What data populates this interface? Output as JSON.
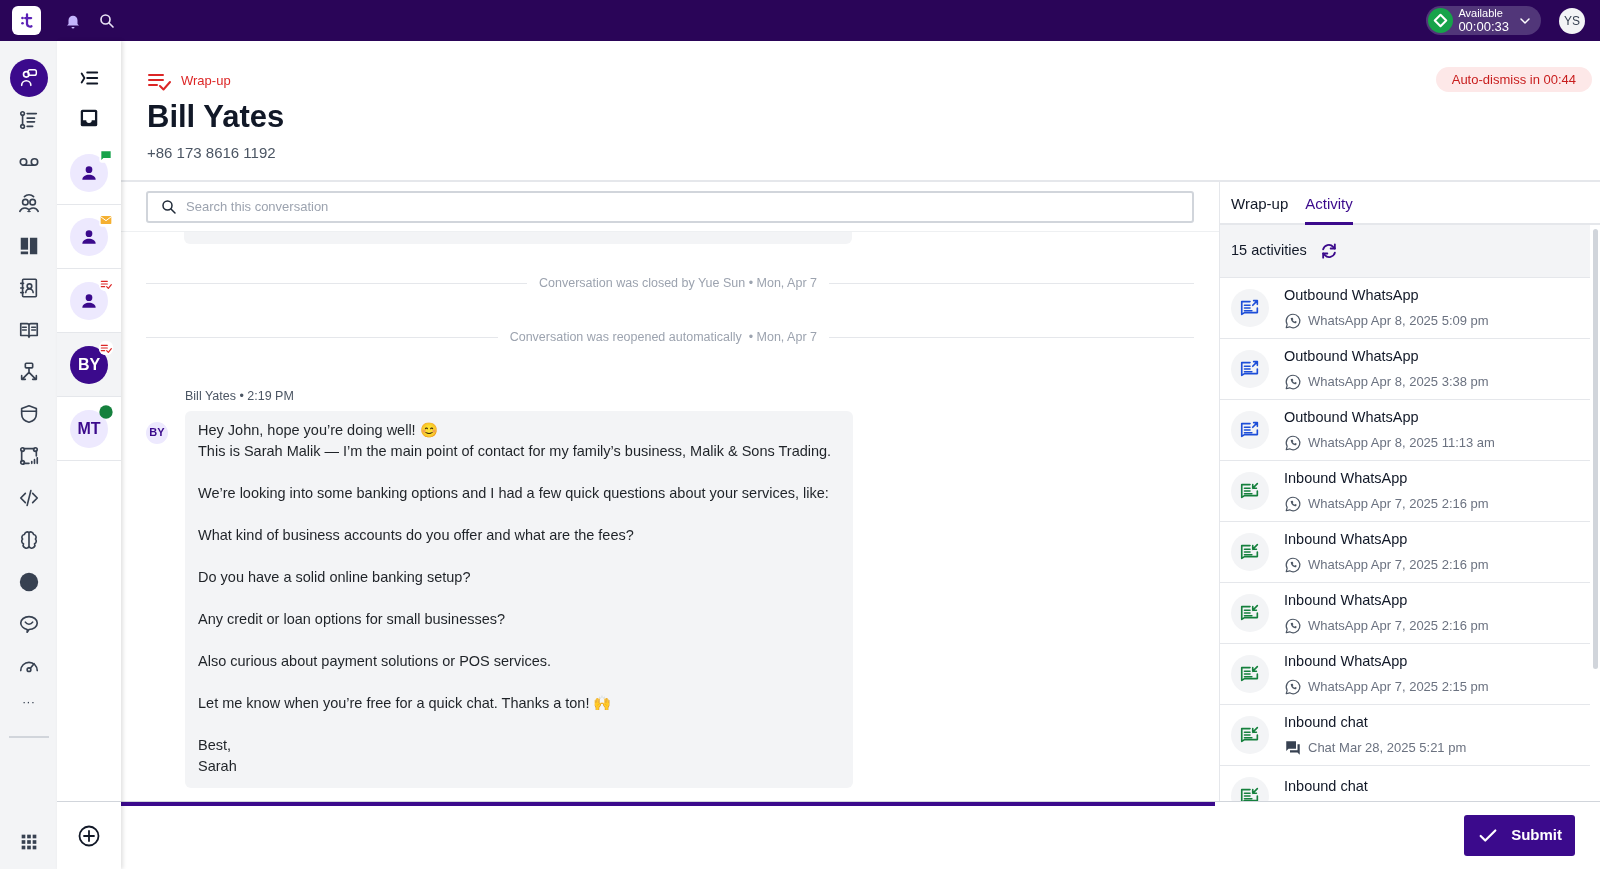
{
  "topbar": {
    "status": {
      "label": "Available",
      "timer": "00:00:33"
    },
    "avatar": "YS"
  },
  "rail": {
    "items": [
      {
        "selected": true
      },
      {
        "selected": false
      },
      {
        "selected": false
      },
      {
        "selected": false
      },
      {
        "selected": false
      },
      {
        "selected": false
      },
      {
        "selected": false
      },
      {
        "selected": false
      },
      {
        "selected": false
      },
      {
        "selected": false
      },
      {
        "selected": false
      },
      {
        "selected": false
      },
      {
        "selected": false
      },
      {
        "selected": false
      },
      {
        "selected": false
      }
    ],
    "more": "···"
  },
  "conversations": [
    {
      "kind": "person",
      "badge": {
        "kind": "chat"
      },
      "selected": false
    },
    {
      "kind": "person",
      "badge": {
        "kind": "mail"
      },
      "selected": false
    },
    {
      "kind": "person",
      "badge": {
        "kind": "wrapup"
      },
      "selected": false
    },
    {
      "kind": "initials",
      "initials": "BY",
      "badge": {
        "kind": "wrapup"
      },
      "selected": true
    },
    {
      "kind": "initials",
      "initials": "MT",
      "badge": {
        "kind": "online"
      },
      "selected": false
    }
  ],
  "header": {
    "state": "Wrap-up",
    "name": "Bill Yates",
    "phone": "+86 173 8616 1192",
    "auto_dismiss": "Auto-dismiss in 00:44"
  },
  "search": {
    "placeholder": "Search this conversation"
  },
  "events": [
    "Conversation was closed by Yue Sun • Mon, Apr 7",
    "Conversation was reopened automatically  • Mon, Apr 7"
  ],
  "message": {
    "avatar": "BY",
    "meta": "Bill Yates • 2:19 PM",
    "paragraphs": [
      [
        "Hey John, hope you’re doing well! 😊",
        "This is Sarah Malik — I’m the main point of contact for my family’s business, Malik & Sons Trading."
      ],
      [
        "We’re looking into some banking options and I had a few quick questions about your services, like:"
      ],
      [
        "What kind of business accounts do you offer and what are the fees?"
      ],
      [
        "Do you have a solid online banking setup?"
      ],
      [
        "Any credit or loan options for small businesses?"
      ],
      [
        "Also curious about payment solutions or POS services."
      ],
      [
        "Let me know when you’re free for a quick chat. Thanks a ton! 🙌"
      ],
      [
        "Best,",
        "Sarah"
      ]
    ]
  },
  "panel": {
    "tabs": [
      {
        "label": "Wrap-up",
        "selected": false
      },
      {
        "label": "Activity",
        "selected": true
      }
    ],
    "count": "15 activities",
    "activities": [
      {
        "kind": "outbound",
        "title": "Outbound WhatsApp",
        "channel": {
          "kind": "whatsapp"
        },
        "meta": "WhatsApp Apr 8, 2025 5:09 pm"
      },
      {
        "kind": "outbound",
        "title": "Outbound WhatsApp",
        "channel": {
          "kind": "whatsapp"
        },
        "meta": "WhatsApp Apr 8, 2025 3:38 pm"
      },
      {
        "kind": "outbound",
        "title": "Outbound WhatsApp",
        "channel": {
          "kind": "whatsapp"
        },
        "meta": "WhatsApp Apr 8, 2025 11:13 am"
      },
      {
        "kind": "inbound",
        "title": "Inbound WhatsApp",
        "channel": {
          "kind": "whatsapp"
        },
        "meta": "WhatsApp Apr 7, 2025 2:16 pm"
      },
      {
        "kind": "inbound",
        "title": "Inbound WhatsApp",
        "channel": {
          "kind": "whatsapp"
        },
        "meta": "WhatsApp Apr 7, 2025 2:16 pm"
      },
      {
        "kind": "inbound",
        "title": "Inbound WhatsApp",
        "channel": {
          "kind": "whatsapp"
        },
        "meta": "WhatsApp Apr 7, 2025 2:16 pm"
      },
      {
        "kind": "inbound",
        "title": "Inbound WhatsApp",
        "channel": {
          "kind": "whatsapp"
        },
        "meta": "WhatsApp Apr 7, 2025 2:15 pm"
      },
      {
        "kind": "inbound",
        "title": "Inbound chat",
        "channel": {
          "kind": "chat"
        },
        "meta": "Chat Mar 28, 2025 5:21 pm"
      },
      {
        "kind": "inbound",
        "title": "Inbound chat"
      }
    ]
  },
  "progress": {
    "level": 0.74
  },
  "submit": "Submit"
}
